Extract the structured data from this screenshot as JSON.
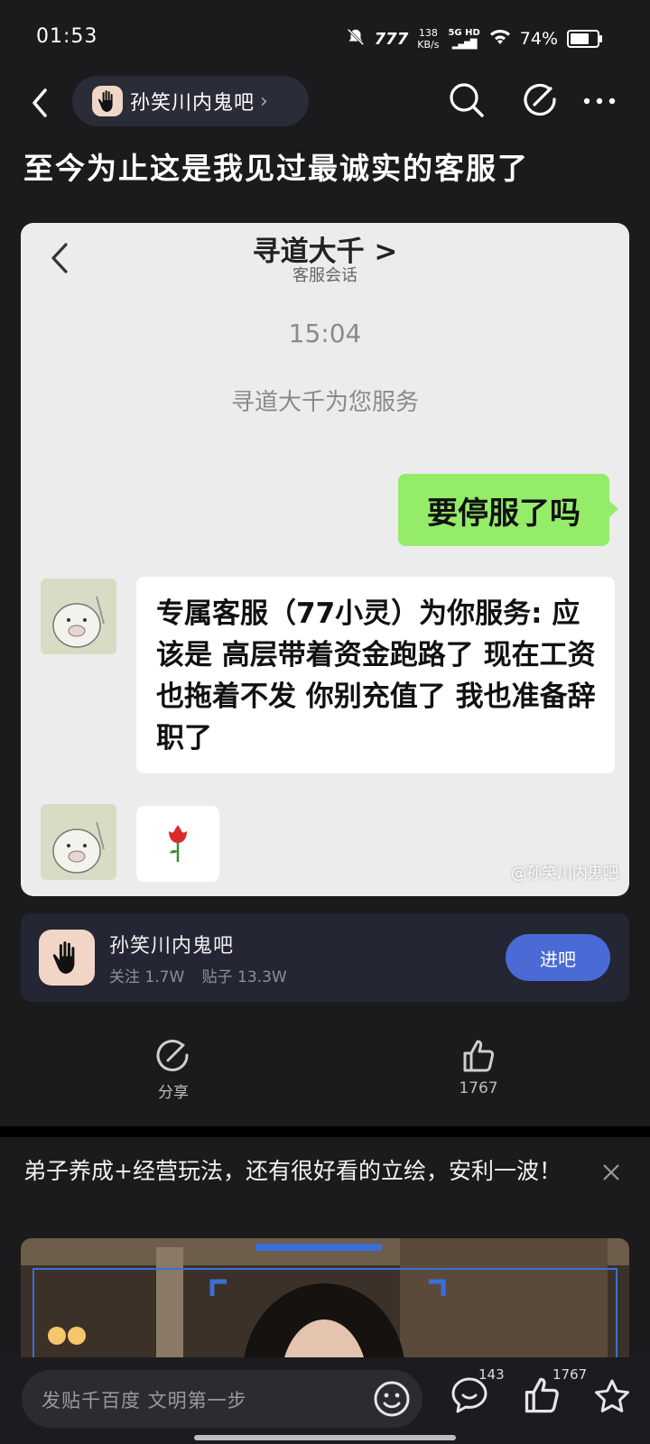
{
  "status_bar": {
    "time": "01:53",
    "net_speed_value": "138",
    "net_speed_unit": "KB/s",
    "network": "5G HD",
    "battery": "74%"
  },
  "nav": {
    "forum_name": "孙笑川内鬼吧"
  },
  "post": {
    "title": "至今为止这是我见过最诚实的客服了",
    "image": {
      "header_title": "寻道大千 >",
      "header_sub": "客服会话",
      "time": "15:04",
      "service_note": "寻道大千为您服务",
      "my_message": "要停服了吗",
      "cs_message": "专属客服（77小灵）为你服务: 应该是 高层带着资金跑路了 现在工资也拖着不发 你别充值了 我也准备辞职了",
      "watermark": "@孙笑川内鬼吧"
    }
  },
  "forum_card": {
    "name": "孙笑川内鬼吧",
    "followers": "关注 1.7W",
    "posts": "贴子 13.3W",
    "join_label": "进吧"
  },
  "actions": {
    "share_label": "分享",
    "like_count": "1767"
  },
  "ad": {
    "text": "弟子养成+经营玩法，还有很好看的立绘，安利一波！"
  },
  "bottom_bar": {
    "placeholder": "发贴千百度 文明第一步",
    "comment_count": "143",
    "like_count": "1767"
  },
  "colors": {
    "background": "#1b1b1d",
    "accent": "#4a6bd6",
    "wechat_green": "#95ec69"
  }
}
